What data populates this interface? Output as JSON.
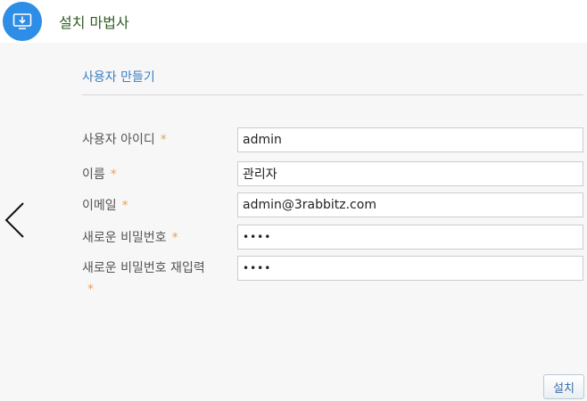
{
  "header": {
    "title": "설치 마법사",
    "icon": "install-download-icon"
  },
  "section": {
    "title": "사용자 만들기"
  },
  "form": {
    "required_mark": "*",
    "fields": [
      {
        "label": "사용자 아이디",
        "value": "admin",
        "type": "text"
      },
      {
        "label": "이름",
        "value": "관리자",
        "type": "text"
      },
      {
        "label": "이메일",
        "value": "admin@3rabbitz.com",
        "type": "text"
      },
      {
        "label": "새로운 비밀번호",
        "value": "1234",
        "type": "password"
      },
      {
        "label": "새로운 비밀번호 재입력",
        "value": "1234",
        "type": "password"
      }
    ]
  },
  "nav": {
    "back_icon": "chevron-left-icon"
  },
  "footer": {
    "install_label": "설치"
  },
  "colors": {
    "accent": "#2e8de6",
    "header_title": "#2f5f22",
    "section_title": "#3a7fc1",
    "required": "#f0a050"
  }
}
